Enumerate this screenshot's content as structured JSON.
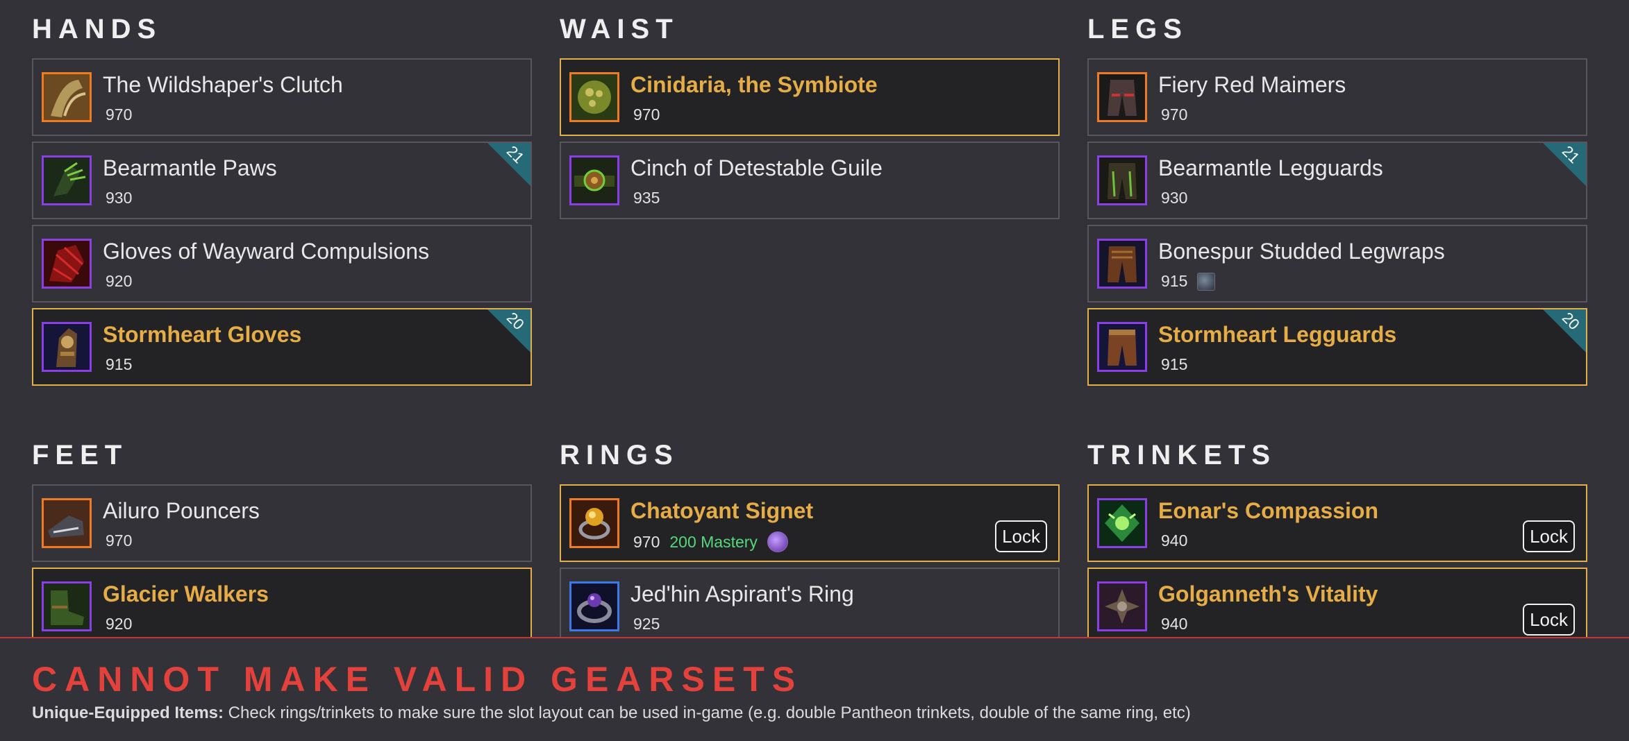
{
  "sections": {
    "hands": {
      "title": "HANDS",
      "items": [
        {
          "name": "The Wildshaper's Clutch",
          "ilvl": "970"
        },
        {
          "name": "Bearmantle Paws",
          "ilvl": "930",
          "badge": "21"
        },
        {
          "name": "Gloves of Wayward Compulsions",
          "ilvl": "920"
        },
        {
          "name": "Stormheart Gloves",
          "ilvl": "915",
          "badge": "20"
        }
      ]
    },
    "waist": {
      "title": "WAIST",
      "items": [
        {
          "name": "Cinidaria, the Symbiote",
          "ilvl": "970"
        },
        {
          "name": "Cinch of Detestable Guile",
          "ilvl": "935"
        }
      ]
    },
    "legs": {
      "title": "LEGS",
      "items": [
        {
          "name": "Fiery Red Maimers",
          "ilvl": "970"
        },
        {
          "name": "Bearmantle Legguards",
          "ilvl": "930",
          "badge": "21"
        },
        {
          "name": "Bonespur Studded Legwraps",
          "ilvl": "915"
        },
        {
          "name": "Stormheart Legguards",
          "ilvl": "915",
          "badge": "20"
        }
      ]
    },
    "feet": {
      "title": "FEET",
      "items": [
        {
          "name": "Ailuro Pouncers",
          "ilvl": "970"
        },
        {
          "name": "Glacier Walkers",
          "ilvl": "920"
        }
      ]
    },
    "rings": {
      "title": "RINGS",
      "items": [
        {
          "name": "Chatoyant Signet",
          "ilvl": "970",
          "stat": "200 Mastery",
          "lock_label": "Lock"
        },
        {
          "name": "Jed'hin Aspirant's Ring",
          "ilvl": "925"
        }
      ]
    },
    "trinkets": {
      "title": "TRINKETS",
      "items": [
        {
          "name": "Eonar's Compassion",
          "ilvl": "940",
          "lock_label": "Lock"
        },
        {
          "name": "Golganneth's Vitality",
          "ilvl": "940",
          "lock_label": "Lock"
        }
      ]
    }
  },
  "colors": {
    "background": "#323238",
    "selected_border": "#e1b04b",
    "selected_name": "#e6ad46",
    "error": "#e2413c",
    "stat": "#55d87a",
    "corner_badge": "#266a78"
  },
  "error": {
    "title": "CANNOT MAKE VALID GEARSETS",
    "label": "Unique-Equipped Items:",
    "message": " Check rings/trinkets to make sure the slot layout can be used in-game (e.g. double Pantheon trinkets, double of the same ring, etc)"
  }
}
